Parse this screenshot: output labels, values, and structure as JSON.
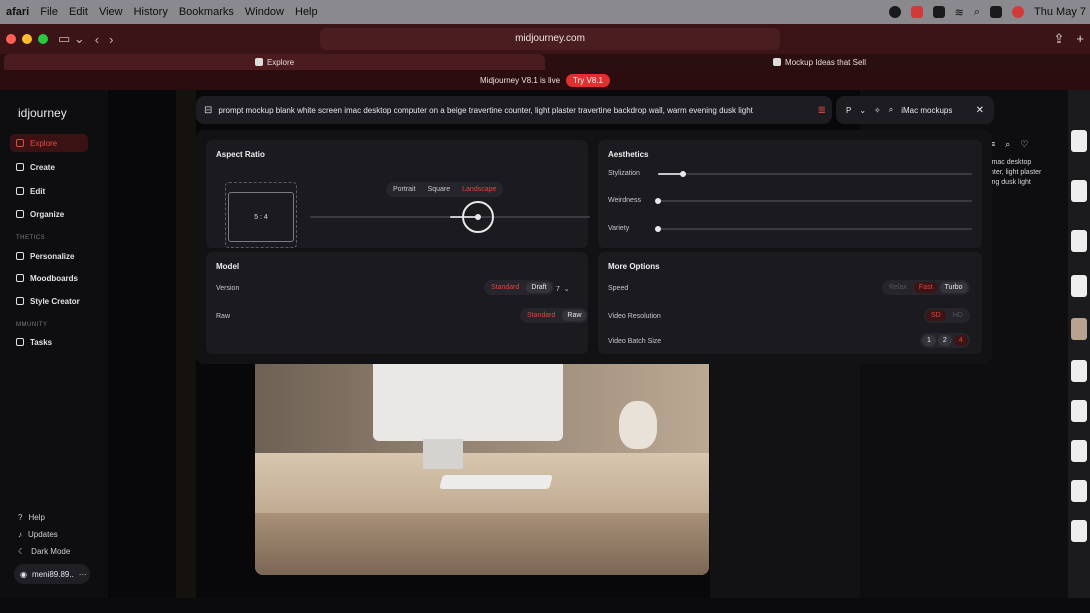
{
  "menubar": {
    "app": "afari",
    "items": [
      "File",
      "Edit",
      "View",
      "History",
      "Bookmarks",
      "Window",
      "Help"
    ],
    "clock": "Thu May 7"
  },
  "browser": {
    "url": "midjourney.com",
    "tabs": [
      {
        "label": "Explore"
      },
      {
        "label": "Mockup Ideas that Sell"
      }
    ]
  },
  "banner": {
    "text": "Midjourney V8.1 is live",
    "cta": "Try V8.1"
  },
  "sidebar": {
    "logo": "idjourney",
    "items": [
      {
        "label": "Explore"
      },
      {
        "label": "Create"
      },
      {
        "label": "Edit"
      },
      {
        "label": "Organize"
      }
    ],
    "section_aesthetics": "THETICS",
    "aesthetics_items": [
      {
        "label": "Personalize"
      },
      {
        "label": "Moodboards"
      },
      {
        "label": "Style Creator"
      }
    ],
    "section_community": "MMUNITY",
    "community_items": [
      {
        "label": "Tasks"
      }
    ],
    "bottom": {
      "help": "Help",
      "updates": "Updates",
      "dark_mode": "Dark Mode",
      "user": "meni89.89..",
      "more": "···"
    }
  },
  "prompt": {
    "text": "prompt mockup blank white screen imac desktop computer on a beige travertine counter, light plaster travertine backdrop wall, warm evening dusk light"
  },
  "search": {
    "p_label": "P",
    "query": "iMac mockups"
  },
  "right_panel": {
    "lines": [
      "imac desktop",
      "nter, light plaster",
      "ing dusk light"
    ]
  },
  "settings": {
    "aspect_ratio": {
      "title": "Aspect Ratio",
      "value": "5 : 4",
      "options": [
        "Portrait",
        "Square",
        "Landscape"
      ],
      "selected": "Landscape",
      "level": 0.6
    },
    "aesthetics": {
      "title": "Aesthetics",
      "rows": [
        {
          "label": "Stylization",
          "level": 0.08
        },
        {
          "label": "Weirdness",
          "level": 0.0
        },
        {
          "label": "Variety",
          "level": 0.0
        }
      ]
    },
    "model": {
      "title": "Model",
      "version_label": "Version",
      "version_options": [
        "Standard",
        "Draft"
      ],
      "version_value": "7",
      "raw_label": "Raw",
      "raw_options": [
        "Standard",
        "Raw"
      ]
    },
    "more_options": {
      "title": "More Options",
      "speed_label": "Speed",
      "speed_options": [
        "Relax",
        "Fast",
        "Turbo"
      ],
      "video_res_label": "Video Resolution",
      "video_res_options": [
        "SD",
        "HD"
      ],
      "video_batch_label": "Video Batch Size",
      "video_batch_options": [
        "1",
        "2",
        "4"
      ]
    }
  },
  "colors": {
    "accent": "#e2433e",
    "toolbar": "#3a1416",
    "panel": "#121215"
  }
}
